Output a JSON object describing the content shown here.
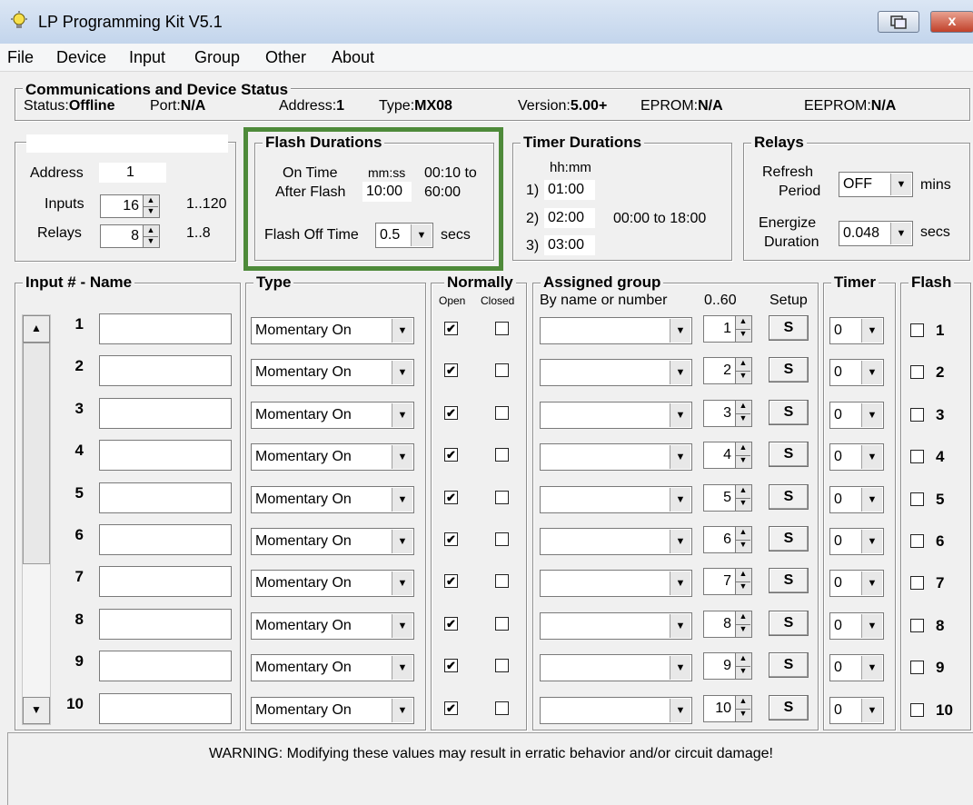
{
  "window": {
    "title": "LP Programming Kit V5.1",
    "close_glyph": "x"
  },
  "menu": [
    "File",
    "Device",
    "Input",
    "Group",
    "Other",
    "About"
  ],
  "comms": {
    "title": "Communications and Device Status",
    "status_label": "Status:",
    "status_value": "Offline",
    "port_label": "Port:",
    "port_value": "N/A",
    "address_label": "Address:",
    "address_value": "1",
    "type_label": "Type:",
    "type_value": "MX08",
    "version_label": "Version:",
    "version_value": "5.00+",
    "eprom_label": "EPROM:",
    "eprom_value": "N/A",
    "eeprom_label": "EEPROM:",
    "eeprom_value": "N/A"
  },
  "device": {
    "address_label": "Address",
    "address_value": "1",
    "inputs_label": "Inputs",
    "inputs_value": "16",
    "inputs_range": "1..120",
    "relays_label": "Relays",
    "relays_value": "8",
    "relays_range": "1..8"
  },
  "flash": {
    "title": "Flash Durations",
    "on_time_label": "On Time",
    "after_flash_label": "After Flash",
    "mmss_label": "mm:ss",
    "value": "10:00",
    "range_from": "00:10 to",
    "range_to": "60:00",
    "off_time_label": "Flash Off Time",
    "off_time_value": "0.5",
    "secs": "secs"
  },
  "timers": {
    "title": "Timer Durations",
    "hhmm_label": "hh:mm",
    "items": [
      {
        "num": "1)",
        "value": "01:00"
      },
      {
        "num": "2)",
        "value": "02:00"
      },
      {
        "num": "3)",
        "value": "03:00"
      }
    ],
    "range": "00:00 to 18:00"
  },
  "relays": {
    "title": "Relays",
    "refresh_label_1": "Refresh",
    "refresh_label_2": "Period",
    "refresh_value": "OFF",
    "refresh_unit": "mins",
    "energize_label_1": "Energize",
    "energize_label_2": "Duration",
    "energize_value": "0.048",
    "energize_unit": "secs"
  },
  "table": {
    "input_title": "Input # - Name",
    "type_title": "Type",
    "normally_title": "Normally",
    "open_label": "Open",
    "closed_label": "Closed",
    "group_title": "Assigned group",
    "by_name_label": "By name or number",
    "range_label": "0..60",
    "setup_label": "Setup",
    "timer_title": "Timer",
    "flash_title": "Flash",
    "rows": [
      {
        "num": "1",
        "name": "",
        "type": "Momentary On",
        "open": true,
        "closed": false,
        "group": "",
        "group_num": "1",
        "setup": "S",
        "timer": "0",
        "flash": false
      },
      {
        "num": "2",
        "name": "",
        "type": "Momentary On",
        "open": true,
        "closed": false,
        "group": "",
        "group_num": "2",
        "setup": "S",
        "timer": "0",
        "flash": false
      },
      {
        "num": "3",
        "name": "",
        "type": "Momentary On",
        "open": true,
        "closed": false,
        "group": "",
        "group_num": "3",
        "setup": "S",
        "timer": "0",
        "flash": false
      },
      {
        "num": "4",
        "name": "",
        "type": "Momentary On",
        "open": true,
        "closed": false,
        "group": "",
        "group_num": "4",
        "setup": "S",
        "timer": "0",
        "flash": false
      },
      {
        "num": "5",
        "name": "",
        "type": "Momentary On",
        "open": true,
        "closed": false,
        "group": "",
        "group_num": "5",
        "setup": "S",
        "timer": "0",
        "flash": false
      },
      {
        "num": "6",
        "name": "",
        "type": "Momentary On",
        "open": true,
        "closed": false,
        "group": "",
        "group_num": "6",
        "setup": "S",
        "timer": "0",
        "flash": false
      },
      {
        "num": "7",
        "name": "",
        "type": "Momentary On",
        "open": true,
        "closed": false,
        "group": "",
        "group_num": "7",
        "setup": "S",
        "timer": "0",
        "flash": false
      },
      {
        "num": "8",
        "name": "",
        "type": "Momentary On",
        "open": true,
        "closed": false,
        "group": "",
        "group_num": "8",
        "setup": "S",
        "timer": "0",
        "flash": false
      },
      {
        "num": "9",
        "name": "",
        "type": "Momentary On",
        "open": true,
        "closed": false,
        "group": "",
        "group_num": "9",
        "setup": "S",
        "timer": "0",
        "flash": false
      },
      {
        "num": "10",
        "name": "",
        "type": "Momentary On",
        "open": true,
        "closed": false,
        "group": "",
        "group_num": "10",
        "setup": "S",
        "timer": "0",
        "flash": false
      }
    ]
  },
  "warning": "WARNING: Modifying these values may result in erratic behavior and/or circuit damage!",
  "colors": {
    "highlight": "#4e8a3a",
    "titlebar": "#c3d5ec",
    "close": "#c1412a"
  },
  "icons": {
    "app": "lightbulb-icon",
    "scroll_up": "▲",
    "scroll_down": "▼",
    "dropdown": "▼",
    "check": "✔"
  }
}
